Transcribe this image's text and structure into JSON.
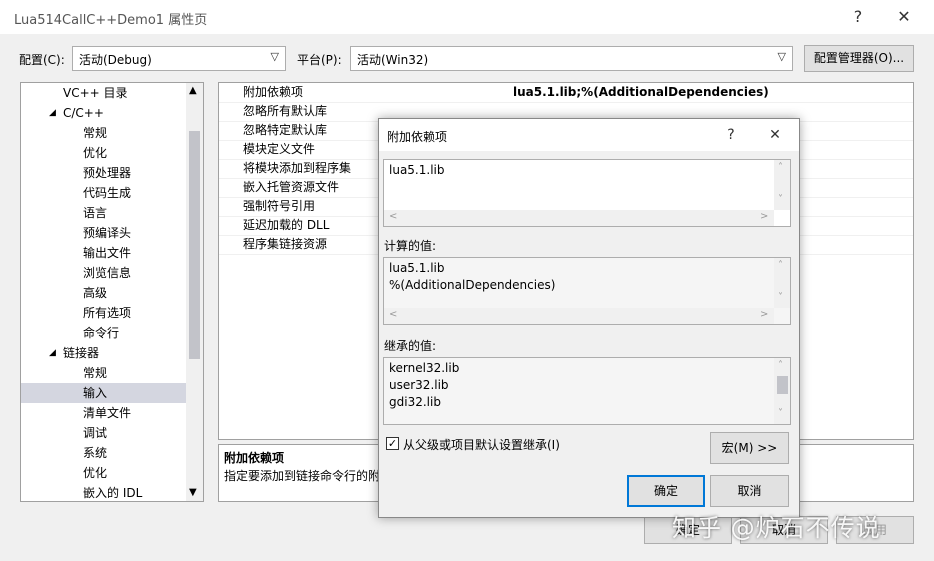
{
  "window": {
    "title": "Lua514CallC++Demo1 属性页",
    "help": "?",
    "close": "✕"
  },
  "config_bar": {
    "config_label": "配置(C):",
    "config_value": "活动(Debug)",
    "platform_label": "平台(P):",
    "platform_value": "活动(Win32)",
    "manager_button": "配置管理器(O)..."
  },
  "tree": [
    {
      "label": "VC++ 目录",
      "expander": ""
    },
    {
      "label": "C/C++",
      "expander": "◢"
    },
    {
      "label": "常规",
      "expander": ""
    },
    {
      "label": "优化",
      "expander": ""
    },
    {
      "label": "预处理器",
      "expander": ""
    },
    {
      "label": "代码生成",
      "expander": ""
    },
    {
      "label": "语言",
      "expander": ""
    },
    {
      "label": "预编译头",
      "expander": ""
    },
    {
      "label": "输出文件",
      "expander": ""
    },
    {
      "label": "浏览信息",
      "expander": ""
    },
    {
      "label": "高级",
      "expander": ""
    },
    {
      "label": "所有选项",
      "expander": ""
    },
    {
      "label": "命令行",
      "expander": ""
    },
    {
      "label": "链接器",
      "expander": "◢"
    },
    {
      "label": "常规",
      "expander": ""
    },
    {
      "label": "输入",
      "expander": ""
    },
    {
      "label": "清单文件",
      "expander": ""
    },
    {
      "label": "调试",
      "expander": ""
    },
    {
      "label": "系统",
      "expander": ""
    },
    {
      "label": "优化",
      "expander": ""
    },
    {
      "label": "嵌入的 IDL",
      "expander": ""
    }
  ],
  "properties": [
    {
      "name": "附加依赖项",
      "value": "lua5.1.lib;%(AdditionalDependencies)"
    },
    {
      "name": "忽略所有默认库",
      "value": ""
    },
    {
      "name": "忽略特定默认库",
      "value": ""
    },
    {
      "name": "模块定义文件",
      "value": ""
    },
    {
      "name": "将模块添加到程序集",
      "value": ""
    },
    {
      "name": "嵌入托管资源文件",
      "value": ""
    },
    {
      "name": "强制符号引用",
      "value": ""
    },
    {
      "name": "延迟加载的 DLL",
      "value": ""
    },
    {
      "name": "程序集链接资源",
      "value": ""
    }
  ],
  "description": {
    "title": "附加依赖项",
    "text": "指定要添加到链接命令行的附"
  },
  "bottom_buttons": {
    "ok": "确定",
    "cancel": "取消",
    "apply": "应用"
  },
  "dialog": {
    "title": "附加依赖项",
    "help": "?",
    "close": "✕",
    "input_value": "lua5.1.lib",
    "computed_label": "计算的值:",
    "computed_lines": [
      "lua5.1.lib",
      "%(AdditionalDependencies)"
    ],
    "inherited_label": "继承的值:",
    "inherited_lines": [
      "kernel32.lib",
      "user32.lib",
      "gdi32.lib"
    ],
    "inherit_checkbox_label": "从父级或项目默认设置继承(I)",
    "inherit_checked": true,
    "macro_button": "宏(M) >>",
    "ok": "确定",
    "cancel": "取消"
  },
  "watermark": "知乎 @炉石不传说"
}
